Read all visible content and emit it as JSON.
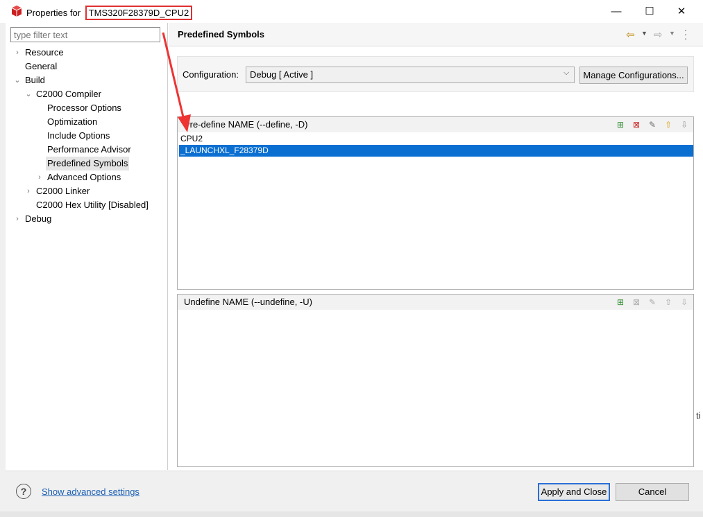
{
  "window": {
    "title_prefix": "Properties for",
    "project_name": "TMS320F28379D_CPU2",
    "min_glyph": "—",
    "max_glyph": "☐",
    "close_glyph": "✕"
  },
  "filter": {
    "placeholder": "type filter text"
  },
  "tree": [
    {
      "label": "Resource",
      "arrow": "›"
    },
    {
      "label": "General",
      "arrow": ""
    },
    {
      "label": "Build",
      "arrow": "⌄"
    },
    {
      "label": "C2000 Compiler",
      "arrow": "⌄"
    },
    {
      "label": "Processor Options",
      "arrow": ""
    },
    {
      "label": "Optimization",
      "arrow": ""
    },
    {
      "label": "Include Options",
      "arrow": ""
    },
    {
      "label": "Performance Advisor",
      "arrow": ""
    },
    {
      "label": "Predefined Symbols",
      "arrow": ""
    },
    {
      "label": "Advanced Options",
      "arrow": "›"
    },
    {
      "label": "C2000 Linker",
      "arrow": "›"
    },
    {
      "label": "C2000 Hex Utility  [Disabled]",
      "arrow": ""
    },
    {
      "label": "Debug",
      "arrow": "›"
    }
  ],
  "page": {
    "title": "Predefined Symbols",
    "config_label": "Configuration:",
    "config_value": "Debug  [ Active ]",
    "manage_label": "Manage Configurations..."
  },
  "define_list": {
    "header": "Pre-define NAME (--define, -D)",
    "items": [
      "CPU2",
      "_LAUNCHXL_F28379D"
    ],
    "selected_index": 1
  },
  "undefine_list": {
    "header": "Undefine NAME (--undefine, -U)",
    "items": []
  },
  "bottom": {
    "help_glyph": "?",
    "advanced_link": "Show advanced settings",
    "apply_label": "Apply and Close",
    "cancel_label": "Cancel"
  },
  "colors": {
    "selection": "#0a6fd1",
    "highlight_box": "#e03030",
    "link": "#1a5fb4"
  },
  "icons": {
    "app": "ti-cube-icon",
    "add": "add-icon",
    "delete": "delete-icon",
    "edit": "edit-icon",
    "move_up": "move-up-icon",
    "move_down": "move-down-icon",
    "nav_back": "back-arrow-icon",
    "nav_forward": "forward-arrow-icon",
    "menu": "kebab-menu-icon"
  },
  "misc": {
    "edge_fragment": "ti"
  }
}
